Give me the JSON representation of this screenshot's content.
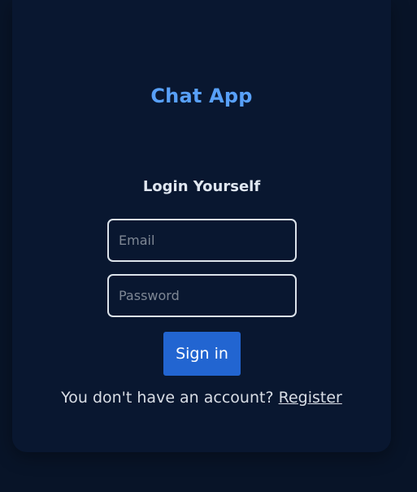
{
  "app": {
    "title": "Chat App"
  },
  "login": {
    "heading": "Login Yourself",
    "email_placeholder": "Email",
    "password_placeholder": "Password",
    "submit_label": "Sign in",
    "register_prompt": "You don't have an account? ",
    "register_link": "Register"
  },
  "colors": {
    "background": "#081428",
    "card": "#091730",
    "accent": "#58a0f8",
    "button": "#2265d1"
  }
}
